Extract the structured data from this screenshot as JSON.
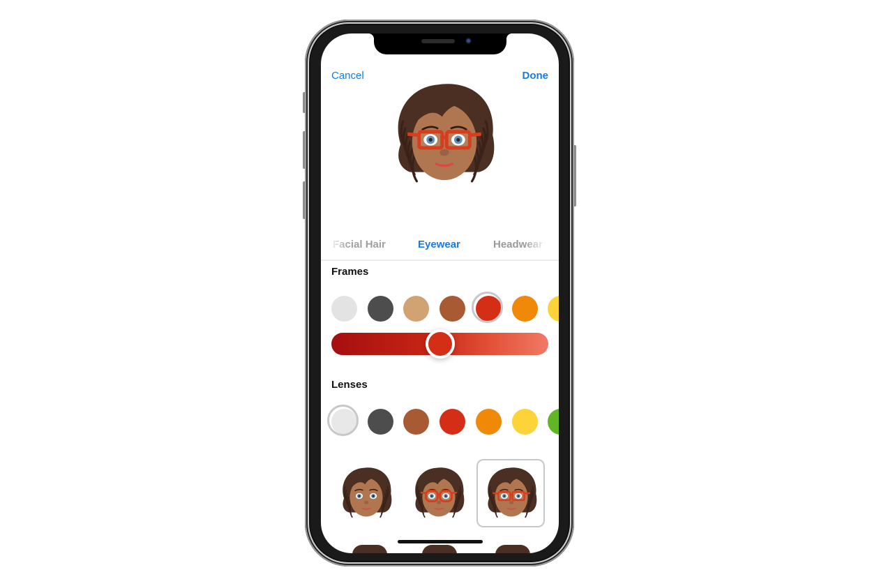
{
  "nav": {
    "cancel_label": "Cancel",
    "done_label": "Done"
  },
  "accent_color": "#1a7ae0",
  "categories": {
    "items": [
      {
        "label": "Facial Hair",
        "active": false
      },
      {
        "label": "Eyewear",
        "active": true
      },
      {
        "label": "Headwear",
        "active": false
      }
    ]
  },
  "frames": {
    "title": "Frames",
    "swatches": [
      {
        "name": "light-gray",
        "color": "#e3e3e3",
        "selected": false
      },
      {
        "name": "dark-gray",
        "color": "#4d4d4d",
        "selected": false
      },
      {
        "name": "tan",
        "color": "#d1a272",
        "selected": false
      },
      {
        "name": "brown",
        "color": "#a85a32",
        "selected": false
      },
      {
        "name": "red",
        "color": "#d42f16",
        "selected": true
      },
      {
        "name": "orange",
        "color": "#f08808",
        "selected": false
      },
      {
        "name": "yellow",
        "color": "#fdd33a",
        "selected": false
      }
    ],
    "shade_slider": {
      "value": 0.5,
      "start_color": "#a50f10",
      "end_color": "#f07a64",
      "thumb_color": "#d42f16"
    }
  },
  "lenses": {
    "title": "Lenses",
    "swatches": [
      {
        "name": "clear",
        "color": "#e8e8e8",
        "selected": true
      },
      {
        "name": "dark-gray",
        "color": "#4d4d4d",
        "selected": false
      },
      {
        "name": "brown",
        "color": "#a85a32",
        "selected": false
      },
      {
        "name": "red",
        "color": "#d42f16",
        "selected": false
      },
      {
        "name": "orange",
        "color": "#f08808",
        "selected": false
      },
      {
        "name": "yellow",
        "color": "#fdd33a",
        "selected": false
      },
      {
        "name": "green",
        "color": "#62b525",
        "selected": false
      }
    ]
  },
  "eyewear_options": [
    {
      "name": "no-glasses",
      "glasses": "none",
      "selected": false
    },
    {
      "name": "round-glasses",
      "glasses": "round",
      "selected": false
    },
    {
      "name": "rectangular-glasses",
      "glasses": "rect",
      "selected": true
    }
  ],
  "memoji": {
    "frame_color": "#d63e1e",
    "skin_color": "#b07650",
    "hair_color": "#4b2f22"
  }
}
